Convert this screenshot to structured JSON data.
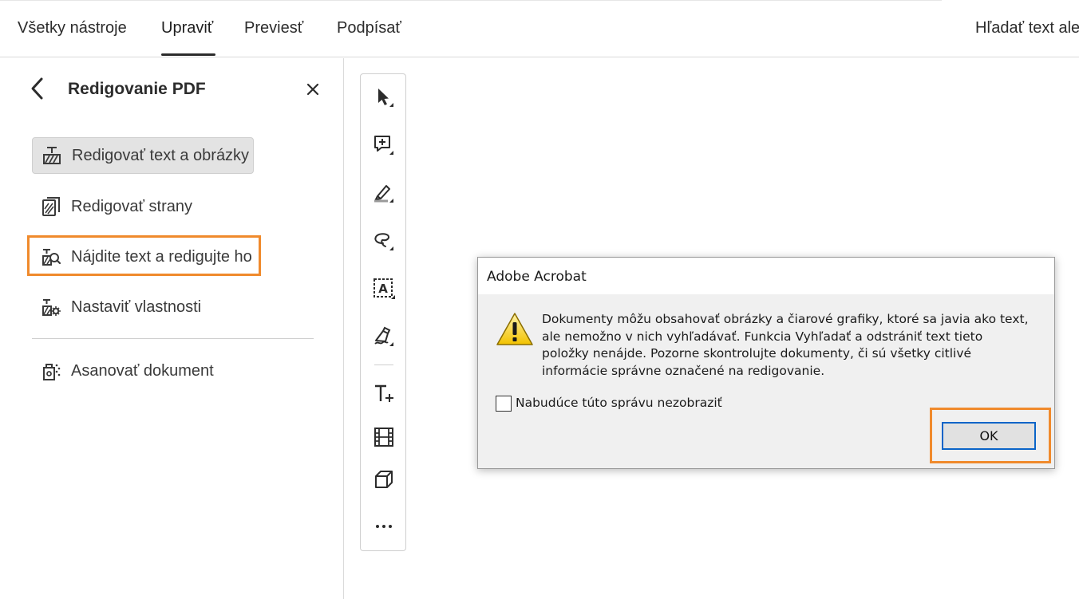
{
  "menubar": {
    "tabs": [
      {
        "label": "Všetky nástroje"
      },
      {
        "label": "Upraviť"
      },
      {
        "label": "Previesť"
      },
      {
        "label": "Podpísať"
      }
    ],
    "active_tab": "Upraviť",
    "search_label": "Hľadať text ale"
  },
  "panel": {
    "title": "Redigovanie PDF",
    "items": [
      {
        "label": "Redigovať text a obrázky",
        "icon": "redact-text-icon",
        "selected": true
      },
      {
        "label": "Redigovať strany",
        "icon": "redact-pages-icon"
      },
      {
        "label": "Nájdite text a redigujte ho",
        "icon": "find-redact-icon",
        "highlighted": true
      },
      {
        "label": "Nastaviť vlastnosti",
        "icon": "redact-properties-icon"
      },
      {
        "label": "Asanovať dokument",
        "icon": "sanitize-document-icon"
      }
    ]
  },
  "toolbar": {
    "tools": [
      "select-icon",
      "add-comment-icon",
      "highlight-icon",
      "draw-freeform-icon",
      "text-select-box-icon",
      "sign-icon",
      "add-text-icon",
      "media-icon",
      "3d-icon",
      "more-icon"
    ]
  },
  "dialog": {
    "title": "Adobe Acrobat",
    "message_lines": [
      "Dokumenty môžu obsahovať obrázky a čiarové grafiky, ktoré sa javia ako text,",
      "ale nemožno v nich vyhľadávať. Funkcia Vyhľadať a odstrániť text tieto",
      "položky nenájde. Pozorne skontrolujte dokumenty, či sú všetky citlivé",
      "informácie správne označené na redigovanie."
    ],
    "checkbox_label": "Nabudúce túto správu nezobraziť",
    "checkbox_checked": false,
    "ok_label": "OK"
  },
  "colors": {
    "highlight": "#f08a2c",
    "ok_border": "#0a64c8",
    "selected_bg": "#e3e3e3"
  }
}
